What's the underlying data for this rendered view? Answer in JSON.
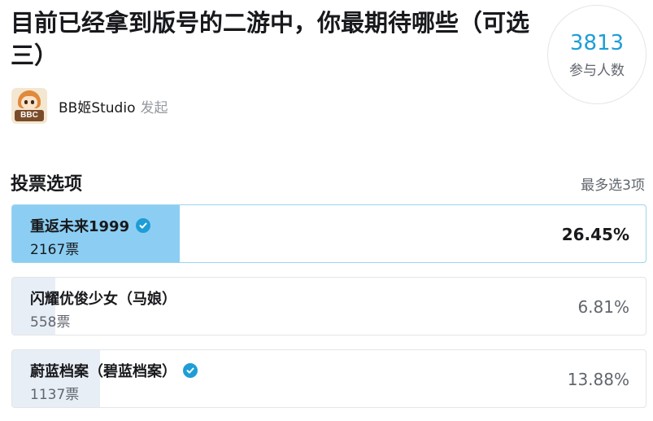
{
  "poll": {
    "title": "目前已经拿到版号的二游中，你最期待哪些（可选三）",
    "participants": "3813",
    "participants_label": "参与人数"
  },
  "author": {
    "name": "BB姬Studio",
    "action": "发起",
    "avatar_text": "BBC"
  },
  "section": {
    "title": "投票选项",
    "hint": "最多选3项"
  },
  "options": [
    {
      "label": "重返未来1999",
      "votes": "2167票",
      "percent": "26.45%",
      "percent_value": 26.45,
      "selected": true,
      "check_icon": "check-circle-icon"
    },
    {
      "label": "闪耀优俊少女（马娘）",
      "votes": "558票",
      "percent": "6.81%",
      "percent_value": 6.81,
      "selected": false
    },
    {
      "label": "蔚蓝档案（碧蓝档案）",
      "votes": "1137票",
      "percent": "13.88%",
      "percent_value": 13.88,
      "selected": true,
      "check_icon": "check-circle-icon"
    }
  ],
  "colors": {
    "accent": "#1e9dd6",
    "selected_fill": "#8ccef3",
    "unselected_fill": "#e8eef6"
  }
}
